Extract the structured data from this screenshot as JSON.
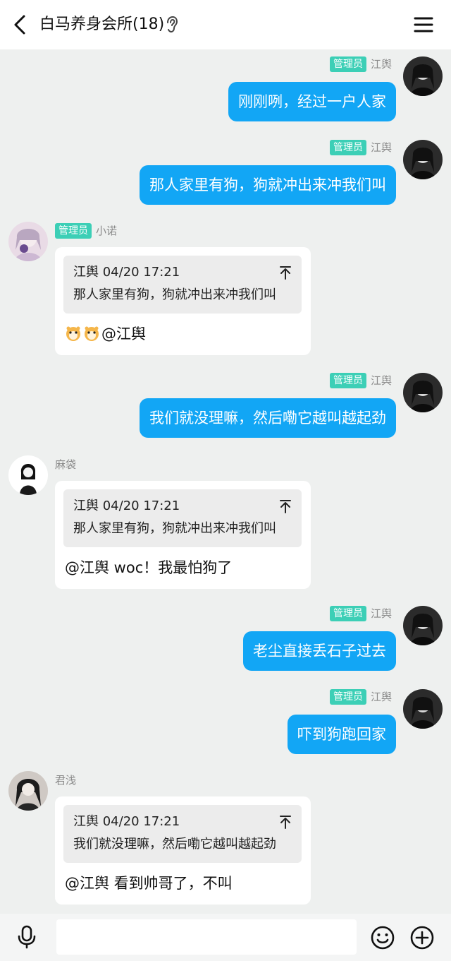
{
  "header": {
    "title": "白马养身会所(18)"
  },
  "messages": [
    {
      "side": "right",
      "badge": "管理员",
      "nick": "江舆",
      "text": "刚刚咧，经过一户人家"
    },
    {
      "side": "right",
      "badge": "管理员",
      "nick": "江舆",
      "text": "那人家里有狗，狗就冲出来冲我们叫"
    },
    {
      "side": "left",
      "badge": "管理员",
      "nick": "小诺",
      "quote_author": "江舆",
      "quote_time": "04/20 17:21",
      "quote_text": "那人家里有狗，狗就冲出来冲我们叫",
      "reply_emoji": [
        "hamster-emoji",
        "hamster-emoji"
      ],
      "reply_text": "@江舆"
    },
    {
      "side": "right",
      "badge": "管理员",
      "nick": "江舆",
      "text": "我们就没理嘛，然后嘞它越叫越起劲"
    },
    {
      "side": "left",
      "nick": "麻袋",
      "quote_author": "江舆",
      "quote_time": "04/20 17:21",
      "quote_text": "那人家里有狗，狗就冲出来冲我们叫",
      "reply_text": "@江舆 woc！我最怕狗了"
    },
    {
      "side": "right",
      "badge": "管理员",
      "nick": "江舆",
      "text": "老尘直接丢石子过去"
    },
    {
      "side": "right",
      "badge": "管理员",
      "nick": "江舆",
      "text": "吓到狗跑回家"
    },
    {
      "side": "left",
      "nick": "君浅",
      "quote_author": "江舆",
      "quote_time": "04/20 17:21",
      "quote_text": "我们就没理嘛，然后嘞它越叫越起劲",
      "reply_text": "@江舆 看到帅哥了，不叫"
    }
  ],
  "input": {
    "placeholder": ""
  },
  "icons": {
    "back": "chevron-left-icon",
    "ear": "ear-icon",
    "menu": "hamburger-menu-icon",
    "mic": "microphone-icon",
    "emoji": "smiley-icon",
    "more": "plus-circle-icon",
    "quote_jump": "jump-to-top-icon"
  },
  "colors": {
    "accent": "#12a6f5",
    "badge": "#3ccfb6",
    "background": "#eef0ef"
  }
}
